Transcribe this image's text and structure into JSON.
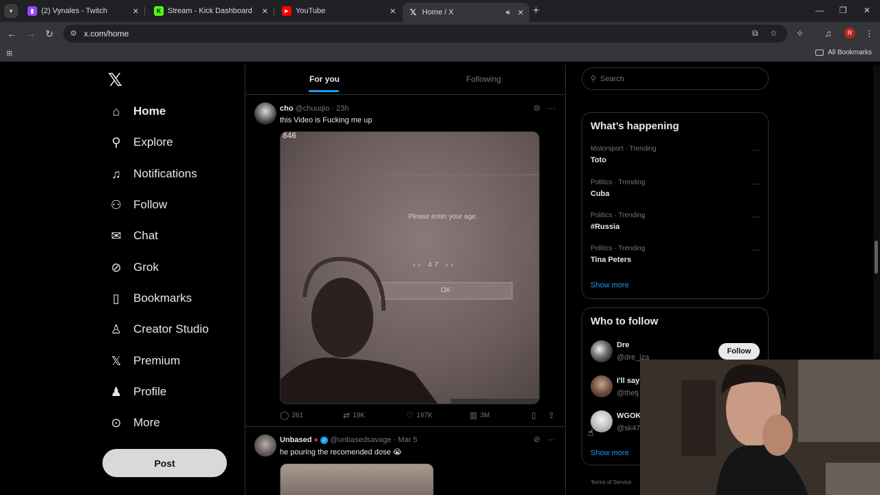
{
  "browser": {
    "tabs": [
      {
        "title": "(2) Vynales - Twitch",
        "icon": "twitch-icon",
        "color": "#9146ff"
      },
      {
        "title": "Stream - Kick Dashboard",
        "icon": "kick-icon",
        "color": "#53fc18"
      },
      {
        "title": "YouTube",
        "icon": "youtube-icon",
        "color": "#ff0000"
      },
      {
        "title": "Home / X",
        "icon": "x-icon",
        "color": "#ffffff"
      }
    ],
    "url": "x.com/home",
    "profile_initial": "R",
    "all_bookmarks": "All Bookmarks"
  },
  "nav": {
    "logo": "𝕏",
    "items": [
      {
        "label": "Home",
        "icon": "home-icon",
        "glyph": "⌂"
      },
      {
        "label": "Explore",
        "icon": "search-icon",
        "glyph": "⚲"
      },
      {
        "label": "Notifications",
        "icon": "bell-icon",
        "glyph": "🔔︎"
      },
      {
        "label": "Follow",
        "icon": "follow-icon",
        "glyph": "⚇"
      },
      {
        "label": "Chat",
        "icon": "mail-icon",
        "glyph": "✉"
      },
      {
        "label": "Grok",
        "icon": "grok-icon",
        "glyph": "⊘"
      },
      {
        "label": "Bookmarks",
        "icon": "bookmark-icon",
        "glyph": "⛉"
      },
      {
        "label": "Creator Studio",
        "icon": "creator-studio-icon",
        "glyph": "♙"
      },
      {
        "label": "Premium",
        "icon": "x-premium-icon",
        "glyph": "𝕏"
      },
      {
        "label": "Profile",
        "icon": "profile-icon",
        "glyph": "♟"
      },
      {
        "label": "More",
        "icon": "more-circle-icon",
        "glyph": "⋯"
      }
    ],
    "post_label": "Post"
  },
  "feed": {
    "tabs": [
      "For you",
      "Following"
    ],
    "tweets": [
      {
        "name": "cho",
        "meta": "@chuuqio · 23h",
        "text": "this Video is Fucking me up",
        "media_text": {
          "corner": "846",
          "prompt": "Please enter your age.",
          "value": "47",
          "ok": "OK"
        },
        "replies": "261",
        "reposts": "19K",
        "likes": "197K",
        "views": "3M"
      },
      {
        "name": "Unbased",
        "meta": "@unbasedsavage · Mar 5",
        "text": "he pouring the recomended dose 😭"
      }
    ]
  },
  "sidebar": {
    "search_placeholder": "Search",
    "happening_title": "What’s happening",
    "trends": [
      {
        "meta": "Motorsport · Trending",
        "name": "Toto"
      },
      {
        "meta": "Politics · Trending",
        "name": "Cuba"
      },
      {
        "meta": "Politics · Trending",
        "name": "#Russia"
      },
      {
        "meta": "Politics · Trending",
        "name": "Tina Peters"
      }
    ],
    "show_more": "Show more",
    "who_to_follow_title": "Who to follow",
    "suggestions": [
      {
        "name": "Dre",
        "handle": "@dre_jza"
      },
      {
        "name": "I'll say",
        "handle": "@thetj"
      },
      {
        "name": "WGOK",
        "handle": "@sk47"
      }
    ],
    "follow_label": "Follow",
    "footer": "Terms of Service"
  }
}
